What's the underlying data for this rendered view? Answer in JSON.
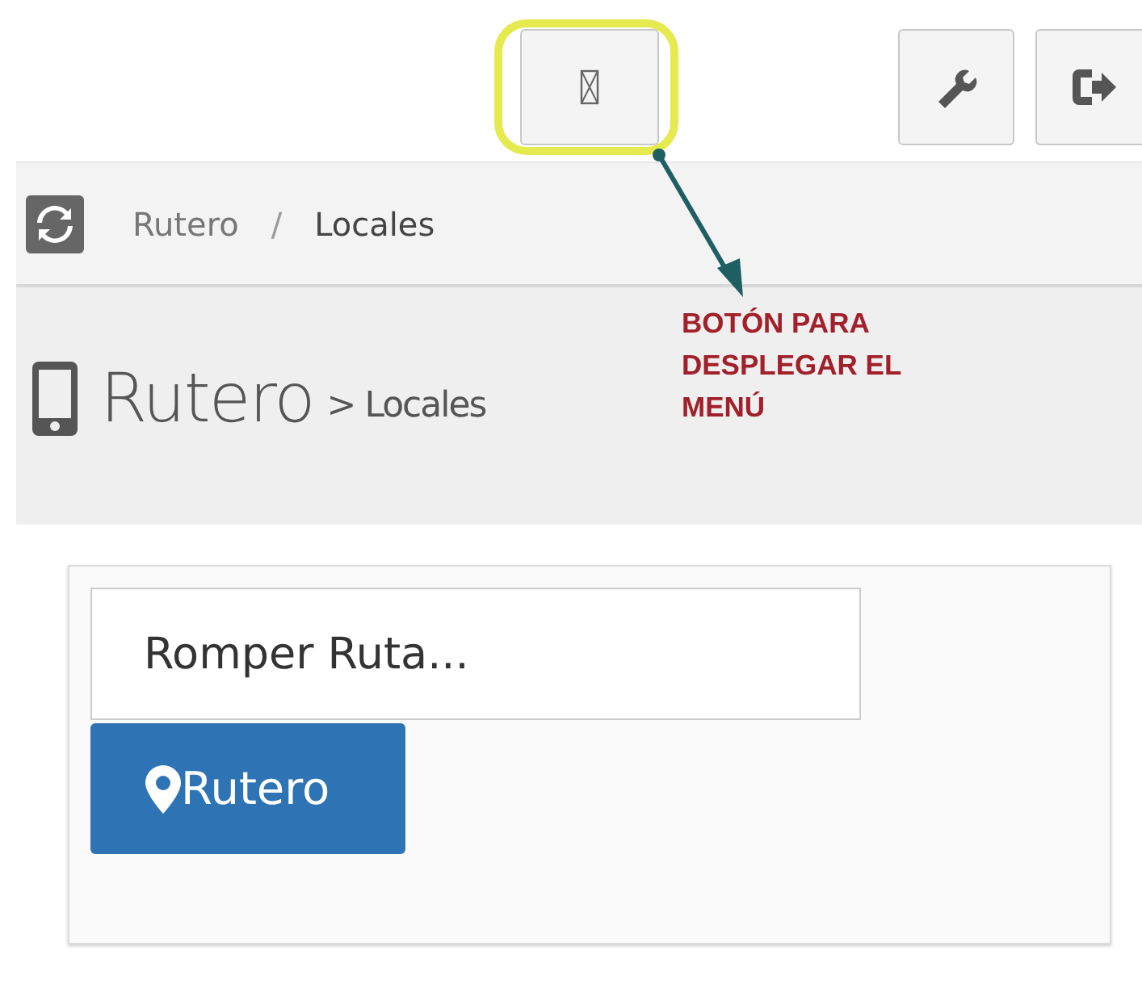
{
  "top_bar": {
    "buttons": [
      {
        "kind": "menu"
      },
      {
        "kind": "wrench"
      },
      {
        "kind": "logout"
      }
    ]
  },
  "breadcrumb": {
    "items": [
      "Rutero",
      "Locales"
    ],
    "separator": "/"
  },
  "page_header": {
    "title": "Rutero",
    "subtitle": "> Locales"
  },
  "form": {
    "search": {
      "placeholder": "Romper Ruta..."
    },
    "button": "Rutero"
  },
  "annotation": {
    "lines": [
      "BOTÓN PARA",
      "DESPLEGAR EL",
      "MENÚ"
    ]
  }
}
